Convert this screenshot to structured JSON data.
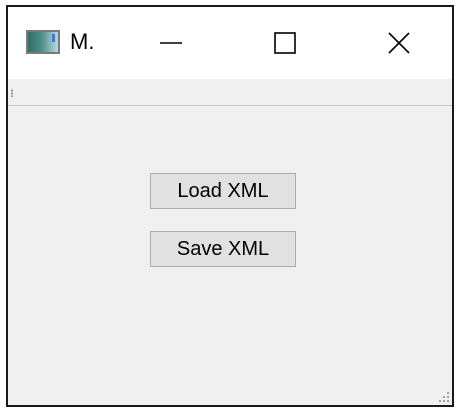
{
  "window": {
    "title": "M.",
    "controls": {
      "minimize_icon": "minimize-icon",
      "maximize_icon": "maximize-icon",
      "close_icon": "close-icon"
    }
  },
  "buttons": {
    "load_label": "Load XML",
    "save_label": "Save XML"
  },
  "colors": {
    "window_bg": "#f0f0f0",
    "titlebar_bg": "#ffffff",
    "button_bg": "#e1e1e1",
    "button_border": "#adadad",
    "frame": "#1a1a1a"
  }
}
